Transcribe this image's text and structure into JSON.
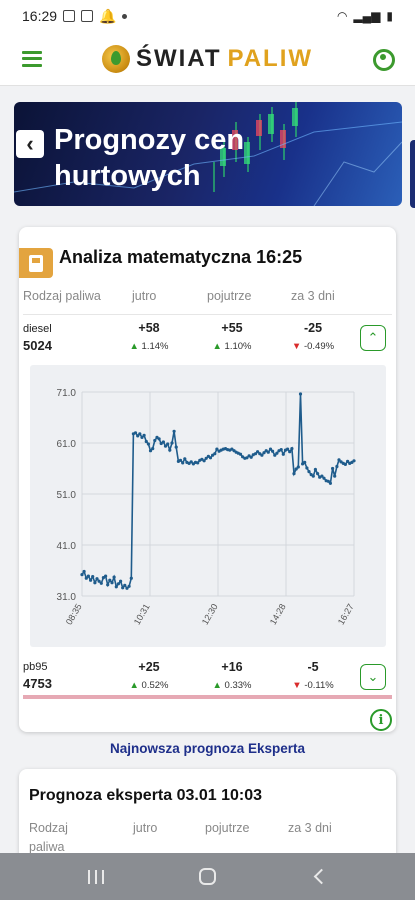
{
  "status_bar": {
    "time": "16:29"
  },
  "app": {
    "logo_part1": "ŚWIAT",
    "logo_part2": "PALIW"
  },
  "banner": {
    "title": "Prognozy cen hurtowych"
  },
  "analysis": {
    "title": "Analiza matematyczna 16:25",
    "headers": [
      "Rodzaj paliwa",
      "jutro",
      "pojutrze",
      "za 3 dni"
    ],
    "fuels": [
      {
        "name": "diesel",
        "price": "5024",
        "deltas": [
          {
            "value": "+58",
            "pct": "1.14%",
            "dir": "up"
          },
          {
            "value": "+55",
            "pct": "1.10%",
            "dir": "up"
          },
          {
            "value": "-25",
            "pct": "-0.49%",
            "dir": "down"
          }
        ]
      },
      {
        "name": "pb95",
        "price": "4753",
        "deltas": [
          {
            "value": "+25",
            "pct": "0.52%",
            "dir": "up"
          },
          {
            "value": "+16",
            "pct": "0.33%",
            "dir": "up"
          },
          {
            "value": "-5",
            "pct": "-0.11%",
            "dir": "down"
          }
        ]
      }
    ]
  },
  "chart_data": {
    "type": "line",
    "title": "",
    "xlabel": "",
    "ylabel": "",
    "x_ticks": [
      "08:35",
      "10:31",
      "12:30",
      "14:28",
      "16:27"
    ],
    "y_ticks": [
      "71.0",
      "61.0",
      "51.0",
      "41.0",
      "31.0"
    ],
    "ylim": [
      31,
      71
    ],
    "grid": true,
    "series": [
      {
        "x": [
          0,
          1,
          2,
          3,
          4,
          5,
          6,
          7,
          8,
          9,
          10,
          11,
          12,
          13,
          14,
          15,
          16,
          17,
          18,
          19,
          20,
          21,
          22,
          23,
          24,
          25,
          26,
          27,
          28,
          29,
          30,
          31,
          32,
          33,
          34,
          35,
          36,
          37,
          38,
          39,
          40,
          41,
          42,
          43,
          44,
          45,
          46,
          47,
          48,
          49,
          50,
          51,
          52,
          53,
          54,
          55,
          56,
          57,
          58,
          59,
          60,
          61,
          62,
          63,
          64,
          65,
          66,
          67,
          68,
          69,
          70,
          71,
          72,
          73,
          74,
          75,
          76,
          77,
          78,
          79,
          80,
          81,
          82,
          83,
          84,
          85,
          86,
          87,
          88,
          89,
          90,
          91,
          92,
          93,
          94,
          95,
          96,
          97,
          98,
          99,
          100,
          101,
          102,
          103,
          104,
          105,
          106,
          107,
          108,
          109,
          110,
          111,
          112,
          113,
          114,
          115,
          116,
          117,
          118,
          119,
          120,
          121,
          122,
          123,
          124,
          125,
          126,
          127
        ],
        "y": [
          35.2,
          35.8,
          34.5,
          34.9,
          34.1,
          34.8,
          33.6,
          34.4,
          33.9,
          33.5,
          34.6,
          34.9,
          33.2,
          34.1,
          33.6,
          34.7,
          32.8,
          33.4,
          33.9,
          32.6,
          33.1,
          32.5,
          32.9,
          34.5,
          62.8,
          63.0,
          62.4,
          62.8,
          62.1,
          62.5,
          61.3,
          60.8,
          59.5,
          59.9,
          61.5,
          62.1,
          61.8,
          60.9,
          61.2,
          60.4,
          60.8,
          59.6,
          61.0,
          63.3,
          60.2,
          57.4,
          57.6,
          57.1,
          57.9,
          57.2,
          57.0,
          57.3,
          56.9,
          57.2,
          57.1,
          57.6,
          57.8,
          57.5,
          58.0,
          58.4,
          58.1,
          58.6,
          58.9,
          59.8,
          59.4,
          59.6,
          59.8,
          59.9,
          59.7,
          59.6,
          59.8,
          59.5,
          59.2,
          59.0,
          58.8,
          58.3,
          58.0,
          58.1,
          58.5,
          58.2,
          58.7,
          58.9,
          59.3,
          58.9,
          58.6,
          59.1,
          59.5,
          59.2,
          59.8,
          59.4,
          58.6,
          59.0,
          59.5,
          59.7,
          58.8,
          59.6,
          59.8,
          59.3,
          59.9,
          55.0,
          55.9,
          56.3,
          70.6,
          56.9,
          57.2,
          56.1,
          55.4,
          54.8,
          54.5,
          55.8,
          55.0,
          54.3,
          54.5,
          54.1,
          53.6,
          53.5,
          53.1,
          56.0,
          54.5,
          56.4,
          57.7,
          57.3,
          57.0,
          56.8,
          57.4,
          57.0,
          57.2,
          57.5
        ]
      }
    ]
  },
  "expert": {
    "link": "Najnowsza prognoza Eksperta",
    "title": "Prognoza eksperta 03.01 10:03",
    "headers": [
      "Rodzaj paliwa",
      "jutro",
      "pojutrze",
      "za 3 dni"
    ]
  },
  "colors": {
    "green": "#2a9a2a",
    "red": "#d92b2b",
    "line": "#1f5c8c",
    "accent": "#e3a43f"
  },
  "icons": {
    "menu": "hamburger-icon",
    "user": "user-icon",
    "back": "chevron-left-icon",
    "fuel": "fuel-pump-icon",
    "info": "info-icon"
  }
}
